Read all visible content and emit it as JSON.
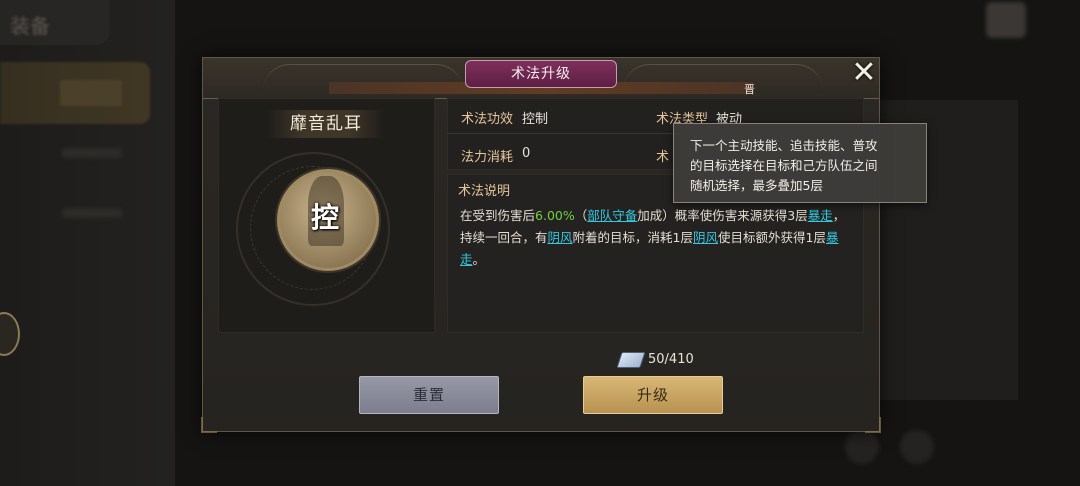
{
  "background": {
    "top_tab_label": "装备"
  },
  "dialog": {
    "title": "术法升级",
    "header_glyph": "晋",
    "close_icon": "close-x-icon"
  },
  "skill": {
    "name": "靡音乱耳",
    "emblem_char": "控"
  },
  "stats": {
    "effect_label": "术法功效",
    "effect_value": "控制",
    "type_label": "术法类型",
    "type_value": "被动",
    "cost_label": "法力消耗",
    "cost_value": "0",
    "partial_label": "术"
  },
  "description": {
    "title": "术法说明",
    "t1": "在受到伤害后",
    "pct": "6.00%",
    "t2": "（",
    "link_troop": "部队守备",
    "t3": "加成）概率使伤害来源获得3层",
    "link_rampage1": "暴走",
    "t4": "，持续一回合，有",
    "link_yinfeng1": "阴风",
    "t5": "附着的目标，消耗1层",
    "link_yinfeng2": "阴风",
    "t6": "使目标额外获得1层",
    "link_rampage2": "暴走",
    "t7": "。"
  },
  "tooltip": {
    "line1": "下一个主动技能、追击技能、普攻",
    "line2": "的目标选择在目标和己方队伍之间",
    "line3": "随机选择，最多叠加5层"
  },
  "resource": {
    "icon": "book-icon",
    "amount": "50/410"
  },
  "buttons": {
    "reset_label": "重置",
    "upgrade_label": "升级"
  },
  "colors": {
    "highlight_green": "#6fd13f",
    "link_cyan": "#31c9e0",
    "gold_label": "#e6c79a"
  }
}
